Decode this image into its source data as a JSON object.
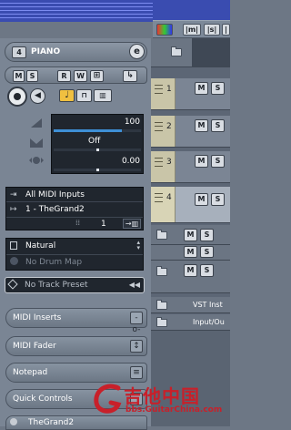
{
  "toolbar": {
    "btn1": "",
    "btn2": "|m|",
    "btn3": "|s|",
    "btn4": "|"
  },
  "track_header": {
    "channel_number": "4",
    "name": "PIANO",
    "edit_button": "e"
  },
  "buttons_row1": {
    "mute": "M",
    "solo": "S",
    "read": "R",
    "write": "W"
  },
  "sliders": {
    "volume_value": "100",
    "pan_value": "Off",
    "delay_value": "0.00"
  },
  "routing": {
    "input": "All MIDI Inputs",
    "output": "1 - TheGrand2",
    "channel": "1"
  },
  "maps": {
    "bank": "Natural",
    "drum_map": "No Drum Map"
  },
  "preset": {
    "track_preset": "No Track Preset"
  },
  "sections": [
    {
      "label": "MIDI Inserts",
      "icon": "-o-"
    },
    {
      "label": "MIDI Fader",
      "icon": "↕"
    },
    {
      "label": "Notepad",
      "icon": "≡"
    },
    {
      "label": "Quick Controls",
      "icon": ""
    }
  ],
  "bottom_track": {
    "label": "TheGrand2"
  },
  "tracks": [
    {
      "number": "1",
      "mute": "M",
      "solo": "S"
    },
    {
      "number": "2",
      "mute": "M",
      "solo": "S"
    },
    {
      "number": "3",
      "mute": "M",
      "solo": "S"
    },
    {
      "number": "4",
      "mute": "M",
      "solo": "S"
    }
  ],
  "folder_tracks": [
    {
      "label": "",
      "mute": "M",
      "solo": "S"
    },
    {
      "label": "",
      "mute": "M",
      "solo": "S"
    },
    {
      "label": "",
      "mute": "M",
      "solo": "S"
    },
    {
      "label": "VST Inst",
      "mute": "",
      "solo": ""
    },
    {
      "label": "Input/Ou",
      "mute": "",
      "solo": ""
    }
  ],
  "watermark": {
    "chinese": "吉他中国",
    "site": "bbs.GuitarChina.com"
  },
  "colors": {
    "top_strip": "#3a4cb0",
    "inspector_bg": "#7a8594",
    "selected_track": "#c9c5a8",
    "dark_panel": "#20262e",
    "watermark": "#c8202a"
  }
}
